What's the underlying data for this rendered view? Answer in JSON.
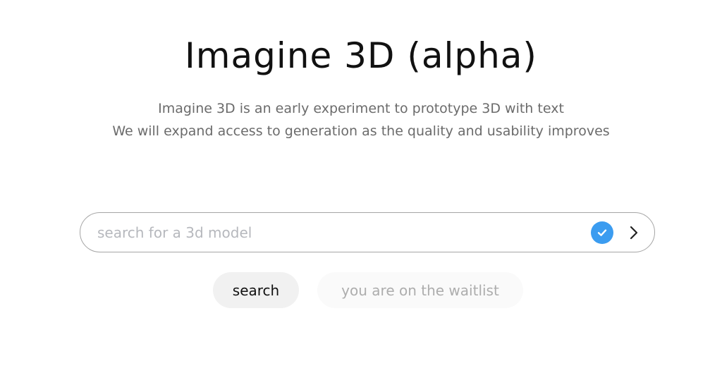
{
  "header": {
    "title": "Imagine 3D (alpha)",
    "subtitle_line1": "Imagine 3D is an early experiment to prototype 3D with text",
    "subtitle_line2": "We will expand access to generation as the quality and usability improves"
  },
  "search": {
    "placeholder": "search for a 3d model",
    "value": "",
    "status_icon": "check-circle-icon",
    "submit_icon": "chevron-right-icon"
  },
  "actions": {
    "search_label": "search",
    "waitlist_label": "you are on the waitlist"
  },
  "colors": {
    "accent": "#3b9cf0",
    "title": "#111111",
    "subtitle": "#6b6b6b",
    "placeholder": "#b6b8bd",
    "button_bg": "#f1f1f1",
    "disabled_text": "#adadad"
  }
}
